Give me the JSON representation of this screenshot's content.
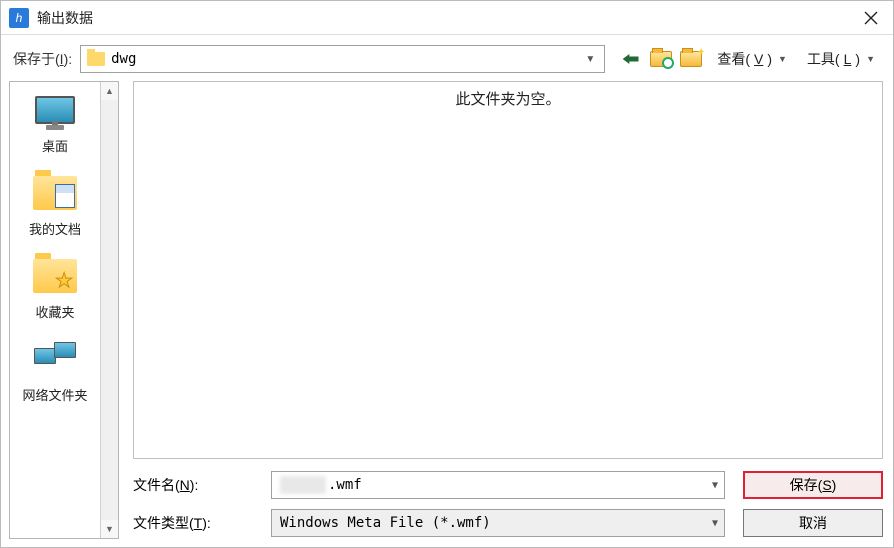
{
  "title": "输出数据",
  "toolbar": {
    "save_in_label": "保存于(",
    "save_in_hotkey": "I",
    "save_in_label_close": "):",
    "path_value": "dwg",
    "view_label": "查看(",
    "view_hotkey": "V",
    "view_label_close": ")",
    "tools_label": "工具(",
    "tools_hotkey": "L",
    "tools_label_close": ")"
  },
  "places": {
    "items": [
      {
        "label": "桌面"
      },
      {
        "label": "我的文档"
      },
      {
        "label": "收藏夹"
      },
      {
        "label": "网络文件夹"
      }
    ]
  },
  "file_area_empty_msg": "此文件夹为空。",
  "filename": {
    "label": "文件名(",
    "hotkey": "N",
    "label_close": "):",
    "value_suffix": ".wmf"
  },
  "filetype": {
    "label": "文件类型(",
    "hotkey": "T",
    "label_close": "):",
    "value": "Windows Meta File (*.wmf)"
  },
  "buttons": {
    "save": "保存(",
    "save_hotkey": "S",
    "save_close": ")",
    "cancel": "取消"
  }
}
